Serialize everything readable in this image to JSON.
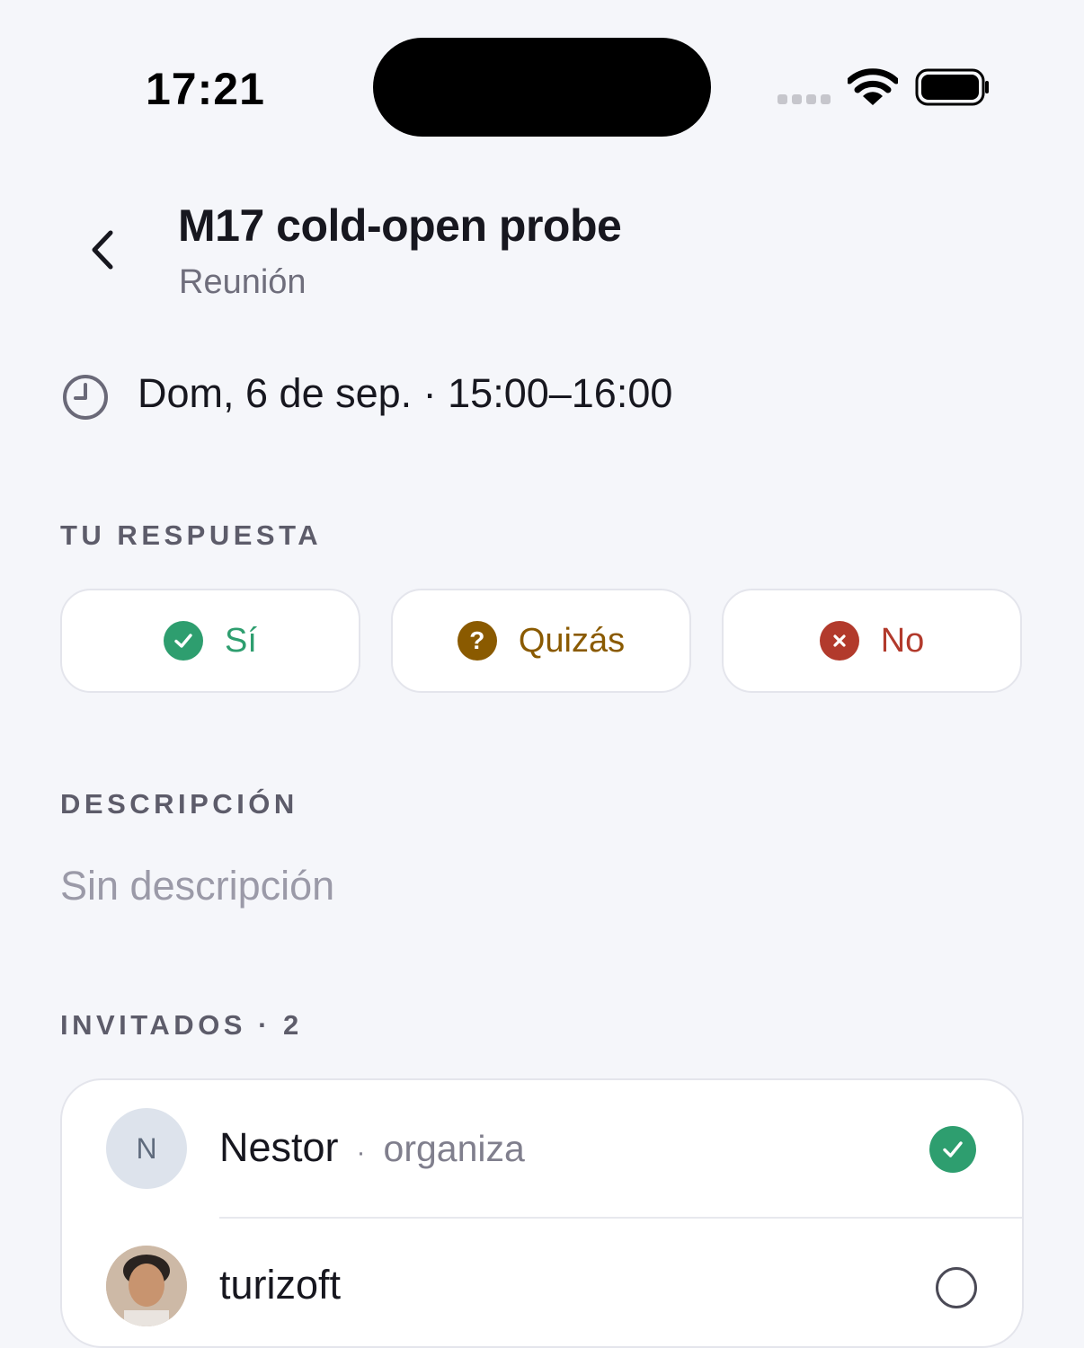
{
  "status_bar": {
    "time": "17:21",
    "signal_icon": "signal-dots-icon",
    "wifi_icon": "wifi-icon",
    "battery_icon": "battery-icon"
  },
  "header": {
    "back_icon": "chevron-left-icon",
    "title": "M17 cold-open probe",
    "subtitle": "Reunión"
  },
  "event": {
    "clock_icon": "clock-icon",
    "datetime": "Dom, 6 de sep. · 15:00–16:00"
  },
  "response": {
    "section_label": "TU RESPUESTA",
    "options": [
      {
        "label": "Sí",
        "icon": "check-circle-icon",
        "color": "#2e9e6f"
      },
      {
        "label": "Quizás",
        "icon": "question-circle-icon",
        "color": "#8a5a00"
      },
      {
        "label": "No",
        "icon": "x-circle-icon",
        "color": "#b23a2c"
      }
    ]
  },
  "description": {
    "section_label": "DESCRIPCIÓN",
    "text": "Sin descripción"
  },
  "guests": {
    "section_label": "INVITADOS · 2",
    "items": [
      {
        "initial": "N",
        "name": "Nestor",
        "separator": "·",
        "role": "organiza",
        "status_icon": "check-circle-icon",
        "status_color": "#2e9e6f"
      },
      {
        "name": "turizoft",
        "status_icon": "empty-circle-icon"
      }
    ]
  },
  "colors": {
    "background": "#f5f6fa",
    "text": "#17171f",
    "muted": "#6f6e7c",
    "card_border": "#e4e5ec"
  }
}
